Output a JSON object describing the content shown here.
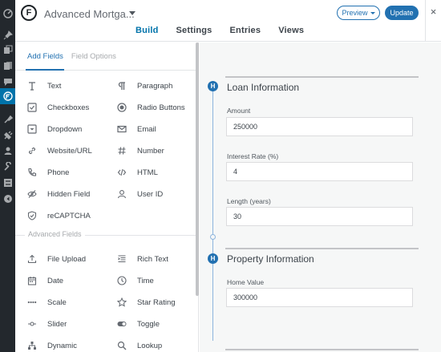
{
  "header": {
    "form_title": "Advanced Mortga...",
    "tabs": [
      "Build",
      "Settings",
      "Entries",
      "Views"
    ],
    "active_tab": "Build",
    "preview_label": "Preview",
    "update_label": "Update",
    "close_label": "×"
  },
  "left_panel": {
    "subtabs": [
      "Add Fields",
      "Field Options"
    ],
    "standard_fields": [
      {
        "label": "Text",
        "icon": "text-icon"
      },
      {
        "label": "Paragraph",
        "icon": "paragraph-icon"
      },
      {
        "label": "Checkboxes",
        "icon": "checkbox-icon"
      },
      {
        "label": "Radio Buttons",
        "icon": "radio-icon"
      },
      {
        "label": "Dropdown",
        "icon": "dropdown-icon"
      },
      {
        "label": "Email",
        "icon": "email-icon"
      },
      {
        "label": "Website/URL",
        "icon": "link-icon"
      },
      {
        "label": "Number",
        "icon": "number-icon"
      },
      {
        "label": "Phone",
        "icon": "phone-icon"
      },
      {
        "label": "HTML",
        "icon": "code-icon"
      },
      {
        "label": "Hidden Field",
        "icon": "eye-slash-icon"
      },
      {
        "label": "User ID",
        "icon": "user-icon"
      },
      {
        "label": "reCAPTCHA",
        "icon": "shield-icon"
      }
    ],
    "advanced_header": "Advanced Fields",
    "advanced_fields": [
      {
        "label": "File Upload",
        "icon": "upload-icon"
      },
      {
        "label": "Rich Text",
        "icon": "rich-text-icon"
      },
      {
        "label": "Date",
        "icon": "calendar-icon"
      },
      {
        "label": "Time",
        "icon": "clock-icon"
      },
      {
        "label": "Scale",
        "icon": "scale-icon"
      },
      {
        "label": "Star Rating",
        "icon": "star-icon"
      },
      {
        "label": "Slider",
        "icon": "slider-icon"
      },
      {
        "label": "Toggle",
        "icon": "toggle-icon"
      },
      {
        "label": "Dynamic",
        "icon": "dynamic-icon"
      },
      {
        "label": "Lookup",
        "icon": "search-icon"
      }
    ]
  },
  "form": {
    "sections": [
      {
        "badge": "H",
        "title": "Loan Information",
        "fields": [
          {
            "label": "Amount",
            "value": "250000"
          },
          {
            "label": "Interest Rate (%)",
            "value": "4"
          },
          {
            "label": "Length (years)",
            "value": "30"
          }
        ]
      },
      {
        "badge": "H",
        "title": "Property Information",
        "fields": [
          {
            "label": "Home Value",
            "value": "300000"
          }
        ]
      }
    ]
  },
  "colors": {
    "accent": "#2271b1",
    "wp_sidebar": "#23282d",
    "wp_active": "#0073aa"
  }
}
